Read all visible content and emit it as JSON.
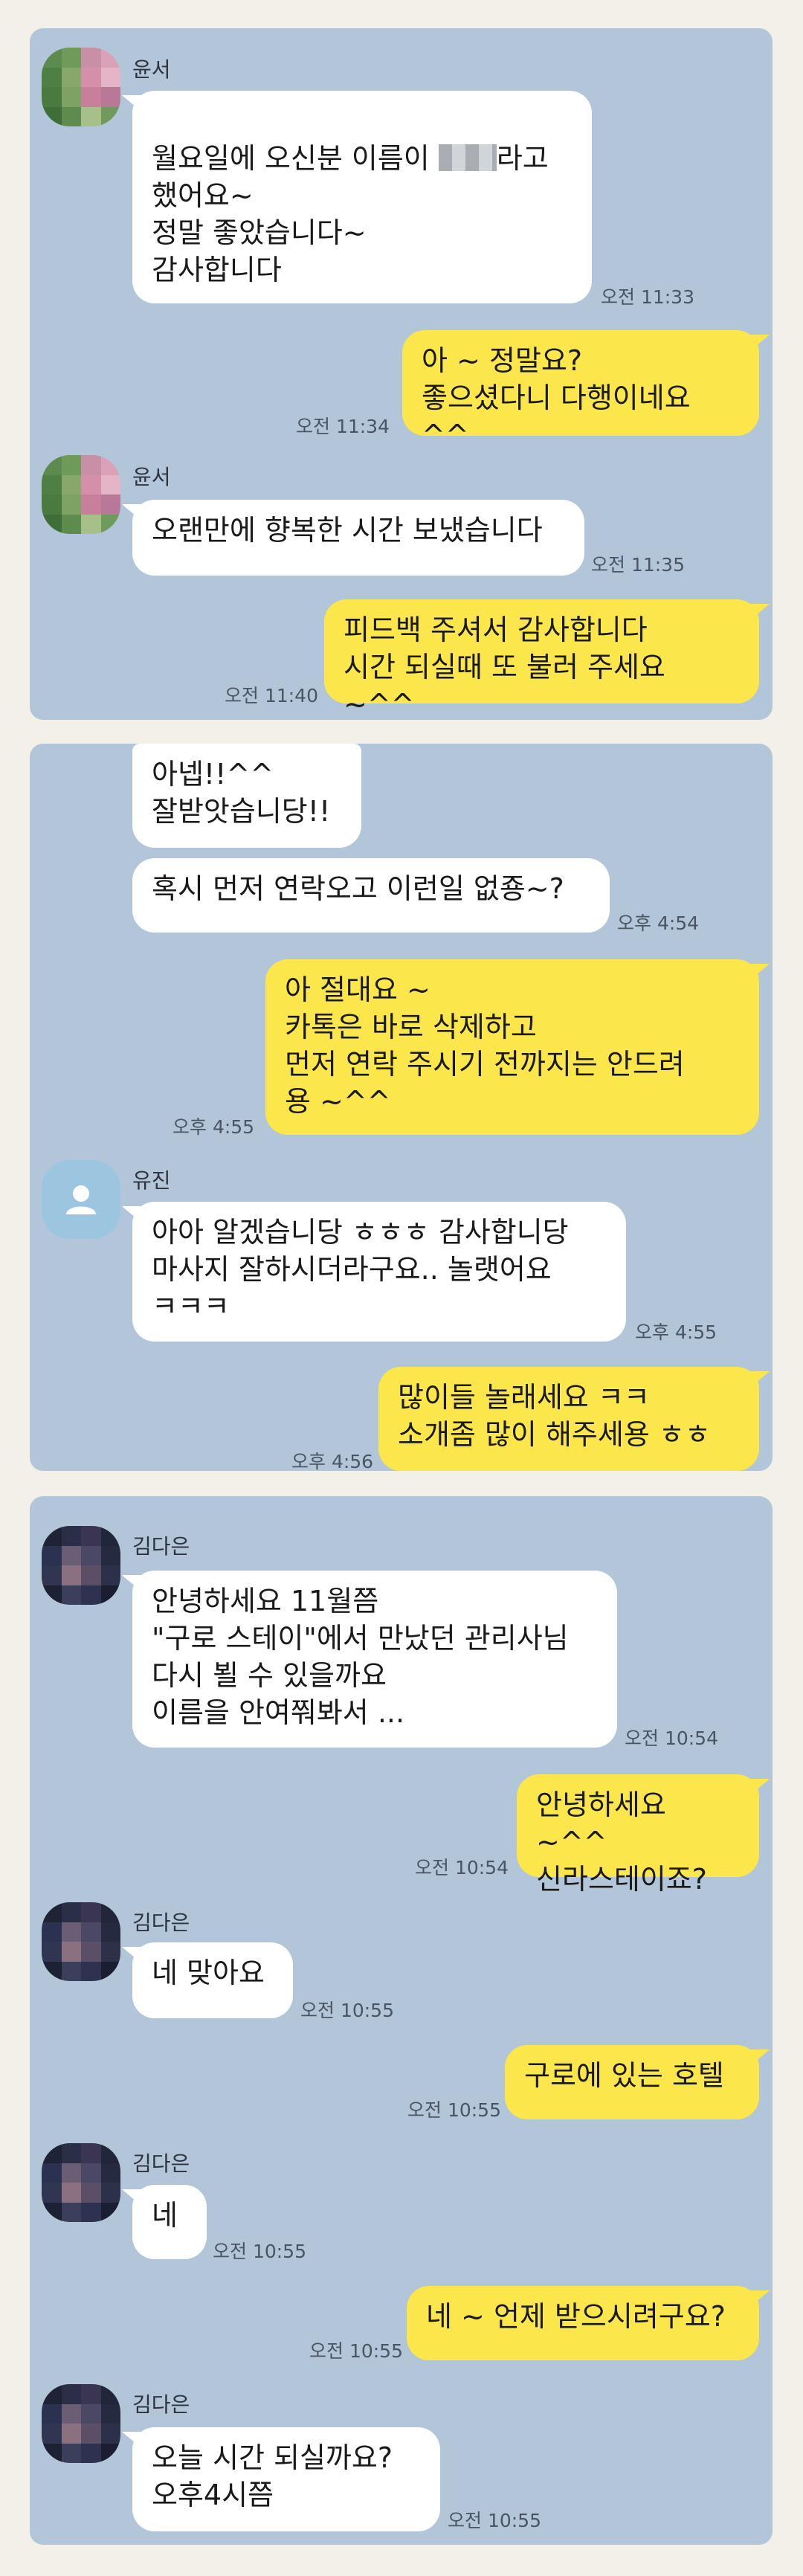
{
  "colors": {
    "background": "#f3efe9",
    "panel": "#b3c5d8",
    "incoming_bubble": "#ffffff",
    "outgoing_bubble": "#fbe64b"
  },
  "panel1": {
    "sender1": "윤서",
    "msg1_line1_a": "월요일에 오신분 이름이 ",
    "msg1_line1_b": "라고",
    "msg1_rest": "했어요~\n정말 좋았습니다~\n감사합니다",
    "msg1_time": "오전 11:33",
    "reply1": "아 ~ 정말요?\n좋으셨다니 다행이네요 ^^",
    "reply1_time": "오전 11:34",
    "sender2": "윤서",
    "msg2": "오랜만에 향복한 시간 보냈습니다",
    "msg2_time": "오전 11:35",
    "reply2": "피드백 주셔서 감사합니다\n시간 되실때 또 불러 주세요 ~^^",
    "reply2_time": "오전 11:40"
  },
  "panel2": {
    "msg1": "아넵!!^^\n잘받앗습니당!!",
    "msg2": "혹시 먼저 연락오고 이런일 없죵~?",
    "msg2_time": "오후 4:54",
    "reply1": "아 절대요 ~\n카톡은 바로 삭제하고\n먼저 연락 주시기 전까지는 안드려\n용 ~^^",
    "reply1_time": "오후 4:55",
    "sender": "유진",
    "msg3": "아아 알겠습니당 ㅎㅎㅎ 감사합니당\n마사지 잘하시더라구요.. 놀랫어요\nㅋㅋㅋ",
    "msg3_time": "오후 4:55",
    "reply2": "많이들 놀래세요 ㅋㅋ\n소개좀 많이 해주세용 ㅎㅎ",
    "reply2_time": "오후 4:56"
  },
  "panel3": {
    "sender": "김다은",
    "msg1": "안녕하세요 11월쯤\n\"구로 스테이\"에서 만났던 관리사님\n다시 뵐 수 있을까요\n이름을 안여쭤봐서 ...",
    "msg1_time": "오전 10:54",
    "reply1": "안녕하세요 ~^^\n신라스테이죠?",
    "reply1_time": "오전 10:54",
    "msg2": "네 맞아요",
    "msg2_time": "오전 10:55",
    "reply2": "구로에 있는 호텔",
    "reply2_time": "오전 10:55",
    "msg3": "네",
    "msg3_time": "오전 10:55",
    "reply3": "네 ~ 언제 받으시려구요?",
    "reply3_time": "오전 10:55",
    "msg4": "오늘 시간 되실까요?\n오후4시쯤",
    "msg4_time": "오전 10:55"
  }
}
